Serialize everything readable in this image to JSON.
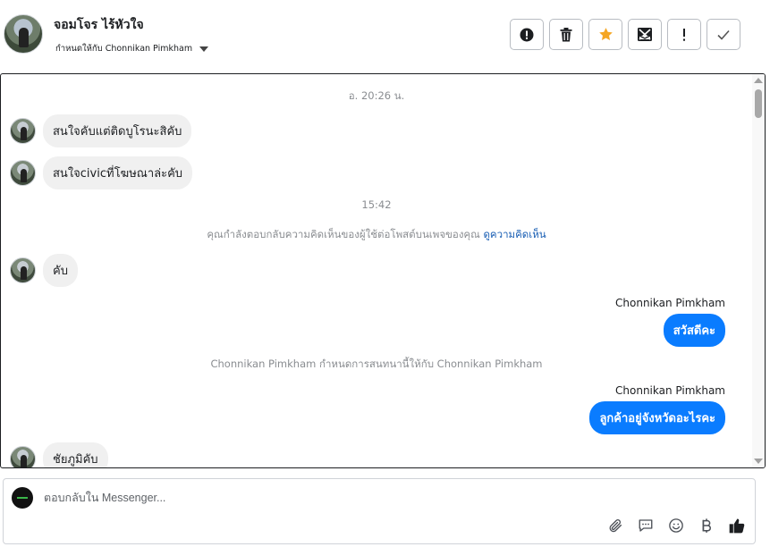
{
  "header": {
    "contact_name": "จอมโจร ไร้หัวใจ",
    "assignee_text": "กำหนดให้กับ Chonnikan Pimkham"
  },
  "actions": [
    {
      "name": "report-spam",
      "icon": "alert-circle-icon"
    },
    {
      "name": "delete",
      "icon": "trash-icon"
    },
    {
      "name": "star",
      "icon": "star-icon",
      "color": "#f5a623"
    },
    {
      "name": "move-to-inbox",
      "icon": "envelope-x-icon"
    },
    {
      "name": "mark-follow-up",
      "icon": "exclamation-icon"
    },
    {
      "name": "mark-done",
      "icon": "checkmark-icon"
    }
  ],
  "thread": {
    "timestamp_1": "อ. 20:26 น.",
    "msg_1": "สนใจคับแต่ติดบูโรนะสิคับ",
    "msg_2": "สนใจcivicที่โฆษณาล่ะคับ",
    "timestamp_2": "15:42",
    "sys_1_text": "คุณกำลังตอบกลับความคิดเห็นของผู้ใช้ต่อโพสต์บนเพจของคุณ",
    "sys_1_link": "ดูความคิดเห็น",
    "msg_3": "คับ",
    "sender_1": "Chonnikan Pimkham",
    "out_1": "สวัสดีคะ",
    "sys_2": "Chonnikan Pimkham กำหนดการสนทนานี้ให้กับ Chonnikan Pimkham",
    "sender_2": "Chonnikan Pimkham",
    "out_2": "ลูกค้าอยู่จังหวัดอะไรคะ",
    "msg_4": "ชัยภูมิคับ"
  },
  "composer": {
    "placeholder": "ตอบกลับใน Messenger...",
    "tools": [
      "paperclip-icon",
      "chat-bubble-icon",
      "smiley-icon",
      "baht-icon",
      "thumbs-up-icon"
    ]
  },
  "colors": {
    "outgoing_bubble": "#0a7cff",
    "incoming_bubble": "#f0f0f0",
    "link": "#1a5fb4",
    "star": "#f5a623"
  }
}
